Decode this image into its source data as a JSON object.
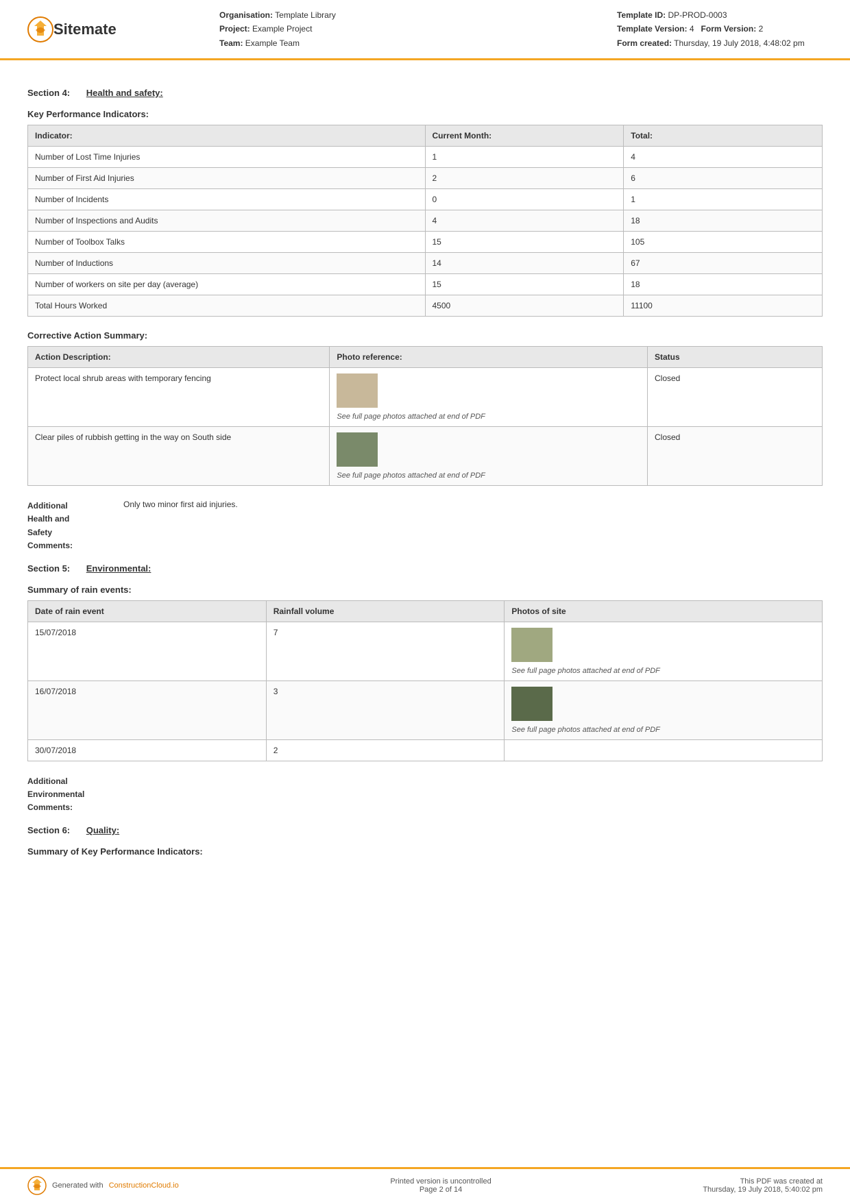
{
  "header": {
    "logo_text": "Sitemate",
    "org_label": "Organisation:",
    "org_value": "Template Library",
    "project_label": "Project:",
    "project_value": "Example Project",
    "team_label": "Team:",
    "team_value": "Example Team",
    "template_id_label": "Template ID:",
    "template_id_value": "DP-PROD-0003",
    "template_version_label": "Template Version:",
    "template_version_value": "4",
    "form_version_label": "Form Version:",
    "form_version_value": "2",
    "form_created_label": "Form created:",
    "form_created_value": "Thursday, 19 July 2018, 4:48:02 pm"
  },
  "section4": {
    "section_num": "Section 4:",
    "section_title": "Health and safety:",
    "kpi_heading": "Key Performance Indicators:",
    "kpi_table": {
      "col1": "Indicator:",
      "col2": "Current Month:",
      "col3": "Total:",
      "rows": [
        {
          "indicator": "Number of Lost Time Injuries",
          "current_month": "1",
          "total": "4"
        },
        {
          "indicator": "Number of First Aid Injuries",
          "current_month": "2",
          "total": "6"
        },
        {
          "indicator": "Number of Incidents",
          "current_month": "0",
          "total": "1"
        },
        {
          "indicator": "Number of Inspections and Audits",
          "current_month": "4",
          "total": "18"
        },
        {
          "indicator": "Number of Toolbox Talks",
          "current_month": "15",
          "total": "105"
        },
        {
          "indicator": "Number of Inductions",
          "current_month": "14",
          "total": "67"
        },
        {
          "indicator": "Number of workers on site per day (average)",
          "current_month": "15",
          "total": "18"
        },
        {
          "indicator": "Total Hours Worked",
          "current_month": "4500",
          "total": "11100"
        }
      ]
    },
    "corrective_heading": "Corrective Action Summary:",
    "corrective_table": {
      "col1": "Action Description:",
      "col2": "Photo reference:",
      "col3": "Status",
      "rows": [
        {
          "description": "Protect local shrub areas with temporary fencing",
          "photo_note": "See full page photos attached at end of PDF",
          "status": "Closed"
        },
        {
          "description": "Clear piles of rubbish getting in the way on South side",
          "photo_note": "See full page photos attached at end of PDF",
          "status": "Closed"
        }
      ]
    },
    "additional_label": "Additional\nHealth and\nSafety\nComments:",
    "additional_value": "Only two minor first aid injuries."
  },
  "section5": {
    "section_num": "Section 5:",
    "section_title": "Environmental:",
    "rain_heading": "Summary of rain events:",
    "rain_table": {
      "col1": "Date of rain event",
      "col2": "Rainfall volume",
      "col3": "Photos of site",
      "rows": [
        {
          "date": "15/07/2018",
          "volume": "7",
          "photo_note": "See full page photos attached at end of PDF"
        },
        {
          "date": "16/07/2018",
          "volume": "3",
          "photo_note": "See full page photos attached at end of PDF"
        },
        {
          "date": "30/07/2018",
          "volume": "2",
          "photo_note": ""
        }
      ]
    },
    "additional_label": "Additional\nEnvironmental\nComments:",
    "additional_value": ""
  },
  "section6": {
    "section_num": "Section 6:",
    "section_title": "Quality:",
    "kpi_heading": "Summary of Key Performance Indicators:"
  },
  "footer": {
    "generated_label": "Generated with",
    "generated_link": "ConstructionCloud.io",
    "uncontrolled": "Printed version is uncontrolled",
    "page": "Page 2 of 14",
    "pdf_created": "This PDF was created at",
    "pdf_date": "Thursday, 19 July 2018, 5:40:02 pm"
  }
}
